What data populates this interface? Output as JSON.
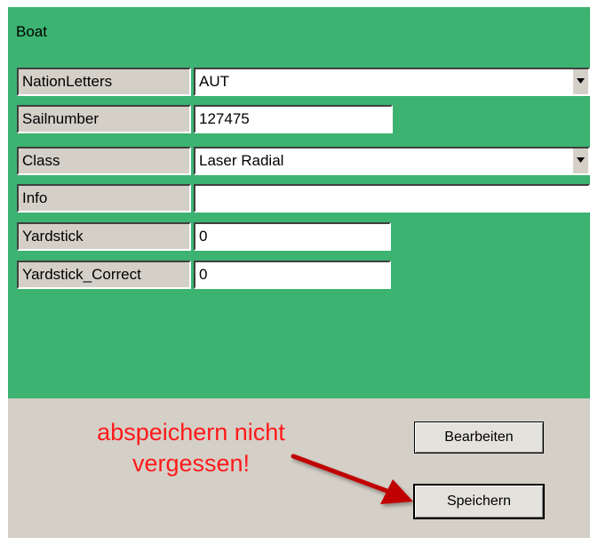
{
  "panel": {
    "title": "Boat"
  },
  "fields": [
    {
      "label": "NationLetters",
      "value": "AUT",
      "type": "dropdown"
    },
    {
      "label": "Sailnumber",
      "value": "127475",
      "type": "text"
    },
    {
      "label": "Class",
      "value": "Laser Radial",
      "type": "dropdown"
    },
    {
      "label": "Info",
      "value": "",
      "type": "text"
    },
    {
      "label": "Yardstick",
      "value": "0",
      "type": "text"
    },
    {
      "label": "Yardstick_Correct",
      "value": "0",
      "type": "text"
    }
  ],
  "buttons": {
    "edit": "Bearbeiten",
    "save": "Speichern"
  },
  "annotation": {
    "line1": "abspeichern nicht",
    "line2": "vergessen!"
  },
  "colors": {
    "panel": "#3cb371",
    "annotation": "#ff1a1a",
    "arrow": "#c00000"
  }
}
